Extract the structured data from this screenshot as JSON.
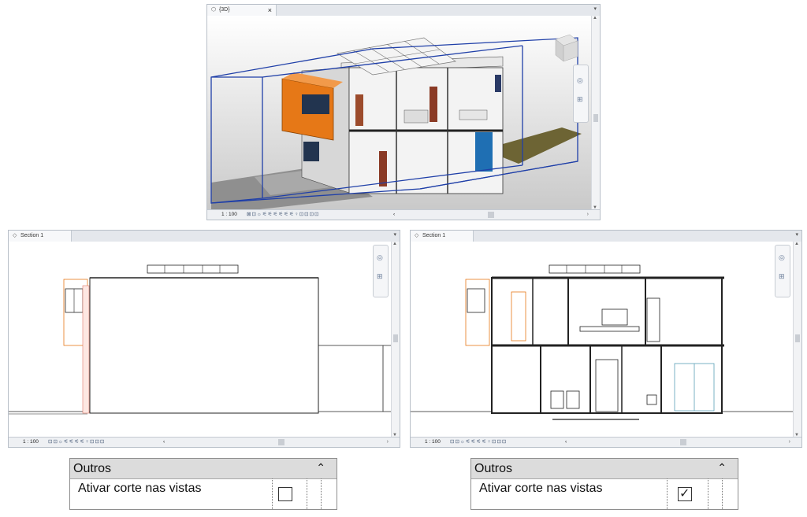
{
  "view3d": {
    "tab_label": "{3D}",
    "close_glyph": "×",
    "scale": "1 : 100",
    "icons": "⊠⊡☼⚟⚟⚟⚟⚟⚟♀⊡⊡⊡⊡",
    "left_arrow": "‹",
    "right_arrow": "›"
  },
  "section_left": {
    "tab_label": "Section 1",
    "scale": "1 : 100",
    "icons": "⊡⊡☼⚟⚟⚟⚟♀⊡⊡⊡",
    "left_arrow": "‹",
    "right_arrow": "›"
  },
  "section_right": {
    "tab_label": "Section 1",
    "scale": "1 : 100",
    "icons": "⊡⊡☼⚟⚟⚟⚟♀⊡⊡⊡",
    "left_arrow": "‹",
    "right_arrow": "›"
  },
  "props_left": {
    "group_title": "Outros",
    "collapse_glyph": "⌃",
    "row_label": "Ativar corte nas vistas",
    "checked": false
  },
  "props_right": {
    "group_title": "Outros",
    "collapse_glyph": "⌃",
    "row_label": "Ativar corte nas vistas",
    "checked": true,
    "check_glyph": "✓"
  },
  "colors": {
    "section_box": "#1f3fa8",
    "orange": "#e67817",
    "blue_panel": "#1f6fb3"
  }
}
